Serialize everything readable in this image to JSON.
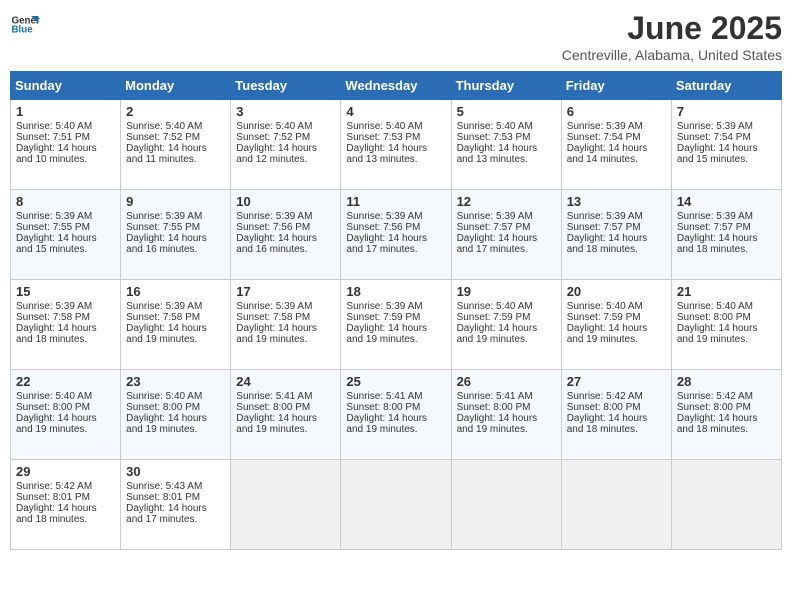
{
  "logo": {
    "general": "General",
    "blue": "Blue"
  },
  "header": {
    "month": "June 2025",
    "location": "Centreville, Alabama, United States"
  },
  "weekdays": [
    "Sunday",
    "Monday",
    "Tuesday",
    "Wednesday",
    "Thursday",
    "Friday",
    "Saturday"
  ],
  "weeks": [
    [
      {
        "day": "1",
        "sunrise": "Sunrise: 5:40 AM",
        "sunset": "Sunset: 7:51 PM",
        "daylight": "Daylight: 14 hours and 10 minutes."
      },
      {
        "day": "2",
        "sunrise": "Sunrise: 5:40 AM",
        "sunset": "Sunset: 7:52 PM",
        "daylight": "Daylight: 14 hours and 11 minutes."
      },
      {
        "day": "3",
        "sunrise": "Sunrise: 5:40 AM",
        "sunset": "Sunset: 7:52 PM",
        "daylight": "Daylight: 14 hours and 12 minutes."
      },
      {
        "day": "4",
        "sunrise": "Sunrise: 5:40 AM",
        "sunset": "Sunset: 7:53 PM",
        "daylight": "Daylight: 14 hours and 13 minutes."
      },
      {
        "day": "5",
        "sunrise": "Sunrise: 5:40 AM",
        "sunset": "Sunset: 7:53 PM",
        "daylight": "Daylight: 14 hours and 13 minutes."
      },
      {
        "day": "6",
        "sunrise": "Sunrise: 5:39 AM",
        "sunset": "Sunset: 7:54 PM",
        "daylight": "Daylight: 14 hours and 14 minutes."
      },
      {
        "day": "7",
        "sunrise": "Sunrise: 5:39 AM",
        "sunset": "Sunset: 7:54 PM",
        "daylight": "Daylight: 14 hours and 15 minutes."
      }
    ],
    [
      {
        "day": "8",
        "sunrise": "Sunrise: 5:39 AM",
        "sunset": "Sunset: 7:55 PM",
        "daylight": "Daylight: 14 hours and 15 minutes."
      },
      {
        "day": "9",
        "sunrise": "Sunrise: 5:39 AM",
        "sunset": "Sunset: 7:55 PM",
        "daylight": "Daylight: 14 hours and 16 minutes."
      },
      {
        "day": "10",
        "sunrise": "Sunrise: 5:39 AM",
        "sunset": "Sunset: 7:56 PM",
        "daylight": "Daylight: 14 hours and 16 minutes."
      },
      {
        "day": "11",
        "sunrise": "Sunrise: 5:39 AM",
        "sunset": "Sunset: 7:56 PM",
        "daylight": "Daylight: 14 hours and 17 minutes."
      },
      {
        "day": "12",
        "sunrise": "Sunrise: 5:39 AM",
        "sunset": "Sunset: 7:57 PM",
        "daylight": "Daylight: 14 hours and 17 minutes."
      },
      {
        "day": "13",
        "sunrise": "Sunrise: 5:39 AM",
        "sunset": "Sunset: 7:57 PM",
        "daylight": "Daylight: 14 hours and 18 minutes."
      },
      {
        "day": "14",
        "sunrise": "Sunrise: 5:39 AM",
        "sunset": "Sunset: 7:57 PM",
        "daylight": "Daylight: 14 hours and 18 minutes."
      }
    ],
    [
      {
        "day": "15",
        "sunrise": "Sunrise: 5:39 AM",
        "sunset": "Sunset: 7:58 PM",
        "daylight": "Daylight: 14 hours and 18 minutes."
      },
      {
        "day": "16",
        "sunrise": "Sunrise: 5:39 AM",
        "sunset": "Sunset: 7:58 PM",
        "daylight": "Daylight: 14 hours and 19 minutes."
      },
      {
        "day": "17",
        "sunrise": "Sunrise: 5:39 AM",
        "sunset": "Sunset: 7:58 PM",
        "daylight": "Daylight: 14 hours and 19 minutes."
      },
      {
        "day": "18",
        "sunrise": "Sunrise: 5:39 AM",
        "sunset": "Sunset: 7:59 PM",
        "daylight": "Daylight: 14 hours and 19 minutes."
      },
      {
        "day": "19",
        "sunrise": "Sunrise: 5:40 AM",
        "sunset": "Sunset: 7:59 PM",
        "daylight": "Daylight: 14 hours and 19 minutes."
      },
      {
        "day": "20",
        "sunrise": "Sunrise: 5:40 AM",
        "sunset": "Sunset: 7:59 PM",
        "daylight": "Daylight: 14 hours and 19 minutes."
      },
      {
        "day": "21",
        "sunrise": "Sunrise: 5:40 AM",
        "sunset": "Sunset: 8:00 PM",
        "daylight": "Daylight: 14 hours and 19 minutes."
      }
    ],
    [
      {
        "day": "22",
        "sunrise": "Sunrise: 5:40 AM",
        "sunset": "Sunset: 8:00 PM",
        "daylight": "Daylight: 14 hours and 19 minutes."
      },
      {
        "day": "23",
        "sunrise": "Sunrise: 5:40 AM",
        "sunset": "Sunset: 8:00 PM",
        "daylight": "Daylight: 14 hours and 19 minutes."
      },
      {
        "day": "24",
        "sunrise": "Sunrise: 5:41 AM",
        "sunset": "Sunset: 8:00 PM",
        "daylight": "Daylight: 14 hours and 19 minutes."
      },
      {
        "day": "25",
        "sunrise": "Sunrise: 5:41 AM",
        "sunset": "Sunset: 8:00 PM",
        "daylight": "Daylight: 14 hours and 19 minutes."
      },
      {
        "day": "26",
        "sunrise": "Sunrise: 5:41 AM",
        "sunset": "Sunset: 8:00 PM",
        "daylight": "Daylight: 14 hours and 19 minutes."
      },
      {
        "day": "27",
        "sunrise": "Sunrise: 5:42 AM",
        "sunset": "Sunset: 8:00 PM",
        "daylight": "Daylight: 14 hours and 18 minutes."
      },
      {
        "day": "28",
        "sunrise": "Sunrise: 5:42 AM",
        "sunset": "Sunset: 8:00 PM",
        "daylight": "Daylight: 14 hours and 18 minutes."
      }
    ],
    [
      {
        "day": "29",
        "sunrise": "Sunrise: 5:42 AM",
        "sunset": "Sunset: 8:01 PM",
        "daylight": "Daylight: 14 hours and 18 minutes."
      },
      {
        "day": "30",
        "sunrise": "Sunrise: 5:43 AM",
        "sunset": "Sunset: 8:01 PM",
        "daylight": "Daylight: 14 hours and 17 minutes."
      },
      {
        "day": "",
        "sunrise": "",
        "sunset": "",
        "daylight": ""
      },
      {
        "day": "",
        "sunrise": "",
        "sunset": "",
        "daylight": ""
      },
      {
        "day": "",
        "sunrise": "",
        "sunset": "",
        "daylight": ""
      },
      {
        "day": "",
        "sunrise": "",
        "sunset": "",
        "daylight": ""
      },
      {
        "day": "",
        "sunrise": "",
        "sunset": "",
        "daylight": ""
      }
    ]
  ]
}
